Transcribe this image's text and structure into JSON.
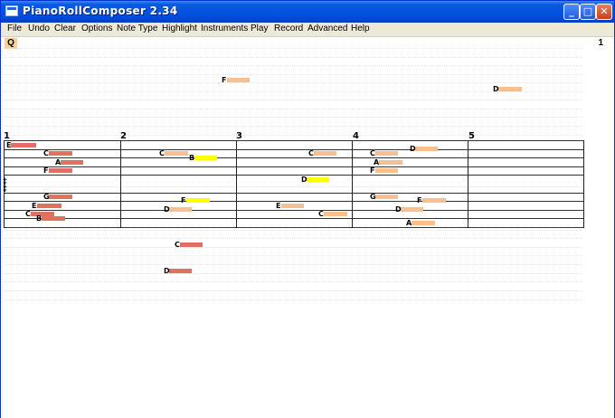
{
  "window": {
    "title": "PianoRollComposer 2.34",
    "controls": {
      "minimize": "_",
      "maximize": "□",
      "close": "✕"
    }
  },
  "menu": [
    "File",
    "Undo",
    "Clear",
    "Options",
    "Note Type",
    "Highlight",
    "Instruments",
    "Play",
    "Record",
    "Advanced",
    "Help"
  ],
  "toolbar": {
    "quantize_label": "Q",
    "page_number": "1"
  },
  "measures": [
    "1",
    "2",
    "3",
    "4",
    "5"
  ],
  "colors": {
    "red": "#e07060",
    "orange": "#f8c090",
    "yellow": "#ffff00"
  },
  "notes": [
    {
      "label": "F",
      "color": "orange"
    },
    {
      "label": "D",
      "color": "orange"
    },
    {
      "label": "E",
      "color": "red"
    },
    {
      "label": "C",
      "color": "red"
    },
    {
      "label": "A",
      "color": "red"
    },
    {
      "label": "F",
      "color": "red"
    },
    {
      "label": "G",
      "color": "red"
    },
    {
      "label": "E",
      "color": "red"
    },
    {
      "label": "C",
      "color": "red"
    },
    {
      "label": "B",
      "color": "red"
    },
    {
      "label": "C",
      "color": "orange"
    },
    {
      "label": "B",
      "color": "yellow"
    },
    {
      "label": "F",
      "color": "yellow"
    },
    {
      "label": "D",
      "color": "orange"
    },
    {
      "label": "C",
      "color": "red"
    },
    {
      "label": "D",
      "color": "red"
    },
    {
      "label": "C",
      "color": "orange"
    },
    {
      "label": "D",
      "color": "yellow"
    },
    {
      "label": "E",
      "color": "orange"
    },
    {
      "label": "C",
      "color": "orange"
    },
    {
      "label": "D",
      "color": "orange"
    },
    {
      "label": "C",
      "color": "orange"
    },
    {
      "label": "A",
      "color": "orange"
    },
    {
      "label": "F",
      "color": "orange"
    },
    {
      "label": "G",
      "color": "orange"
    },
    {
      "label": "F",
      "color": "orange"
    },
    {
      "label": "D",
      "color": "orange"
    },
    {
      "label": "A",
      "color": "orange"
    }
  ]
}
